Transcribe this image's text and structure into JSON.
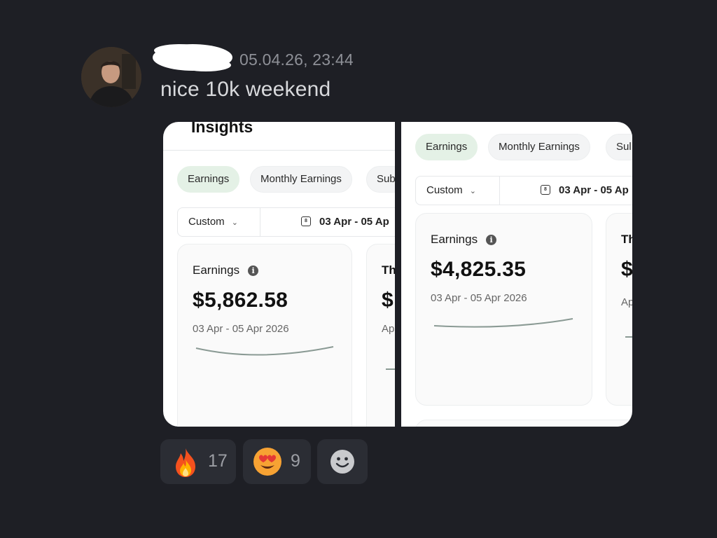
{
  "message": {
    "timestamp": "05.04.26, 23:44",
    "text": "nice 10k weekend"
  },
  "screenshot_left": {
    "title": "Insights",
    "tabs": [
      "Earnings",
      "Monthly Earnings",
      "Sub"
    ],
    "active_tab": "Earnings",
    "filter_label": "Custom",
    "date_range": "03 Apr - 05 Ap",
    "card": {
      "label": "Earnings",
      "amount": "$5,862.58",
      "date": "03 Apr - 05 Apr 2026"
    },
    "peek_card": {
      "label": "Th",
      "amount": "$",
      "date": "Ap"
    }
  },
  "screenshot_right": {
    "tabs": [
      "Earnings",
      "Monthly Earnings",
      "Sul"
    ],
    "active_tab": "Earnings",
    "filter_label": "Custom",
    "date_range": "03 Apr - 05 Ap",
    "card": {
      "label": "Earnings",
      "amount": "$4,825.35",
      "date": "03 Apr - 05 Apr 2026"
    },
    "peek_card": {
      "label": "Th",
      "amount": "$",
      "date": "Ap"
    }
  },
  "reactions": [
    {
      "emoji": "fire-emoji",
      "count": "17"
    },
    {
      "emoji": "heart-eyes-emoji",
      "count": "9"
    },
    {
      "emoji": "add-reaction-icon",
      "count": ""
    }
  ],
  "colors": {
    "background": "#1e1f25",
    "active_tab": "#e4f1e6",
    "sparkline": "#8a9a94",
    "reaction_bg": "#2b2d34"
  }
}
